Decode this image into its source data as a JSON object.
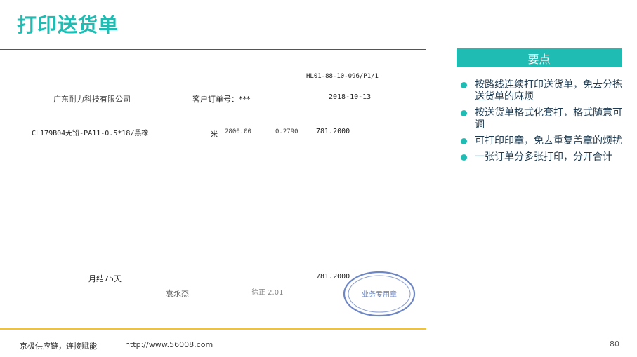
{
  "title": "打印送货单",
  "document": {
    "doc_no": "HL01-88-10-096/P1/1",
    "company": "广东耐力科技有限公司",
    "order_label": "客户订单号：***",
    "date": "2018-10-13",
    "item": {
      "code": "CL179B04无铅-PA11-0.5*18/黑橡",
      "unit": "米",
      "qty": "2800.00",
      "price": "0.2790",
      "amount": "781.2000"
    },
    "payment_terms": "月结75天",
    "total": "781.2000",
    "signature_1": "袁永杰",
    "signature_2": "徐正 2.01",
    "stamp_text": "业务专用章"
  },
  "panel": {
    "header": "要点",
    "bullets": [
      "按路线连续打印送货单，免去分拣送货单的麻烦",
      "按送货单格式化套打，格式随意可调",
      "可打印印章，免去重复盖章的烦扰",
      "一张订单分多张打印，分开合计"
    ]
  },
  "footer": {
    "slogan": "京极供应链，连接赋能",
    "url": "http://www.56008.com",
    "page": "80"
  },
  "colors": {
    "accent": "#1fbcb3",
    "divider": "#f2c230",
    "stamp": "#3d5fb0"
  }
}
